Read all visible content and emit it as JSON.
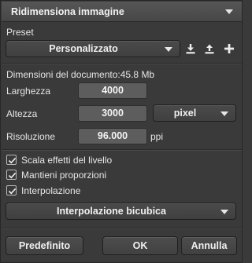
{
  "dialog": {
    "title": "Ridimensiona immagine"
  },
  "preset": {
    "label": "Preset",
    "selected": "Personalizzato",
    "icons": [
      "download-icon",
      "upload-icon",
      "plus-icon"
    ]
  },
  "document": {
    "size_label": "Dimensioni del documento:",
    "size_value": "45.8 Mb"
  },
  "fields": {
    "width_label": "Larghezza",
    "width_value": "4000",
    "height_label": "Altezza",
    "height_value": "3000",
    "unit_selected": "pixel",
    "resolution_label": "Risoluzione",
    "resolution_value": "96.000",
    "resolution_unit": "ppi"
  },
  "options": {
    "scale_effects": {
      "label": "Scala effetti del livello",
      "checked": true
    },
    "constrain_proportions": {
      "label": "Mantieni proporzioni",
      "checked": true
    },
    "interpolation": {
      "label": "Interpolazione",
      "checked": true
    }
  },
  "interpolation_method": {
    "selected": "Interpolazione bicubica"
  },
  "buttons": {
    "default_label": "Predefinito",
    "ok_label": "OK",
    "cancel_label": "Annulla"
  }
}
